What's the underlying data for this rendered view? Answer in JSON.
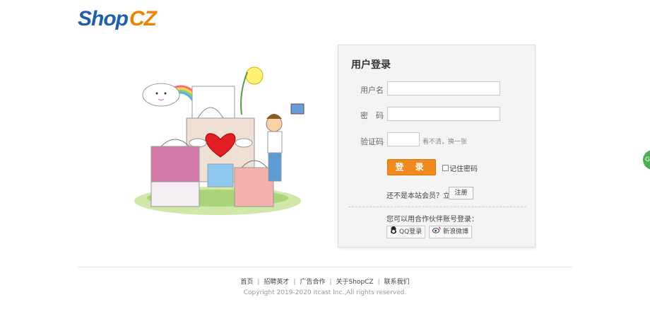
{
  "logo": {
    "shop": "Shop",
    "cz": "CZ"
  },
  "login": {
    "title": "用户登录",
    "username_label": "用户名",
    "password_label": "密　码",
    "captcha_label": "验证码",
    "captcha_hint": "看不清，换一张",
    "login_button": "登 录",
    "remember_label": "记住密码",
    "register_prompt": "还不是本站会员？立即",
    "register_button": "注册",
    "partner_prompt": "您可以用合作伙伴账号登录：",
    "qq_button": "QQ登录",
    "weibo_button": "新浪微博"
  },
  "footer": {
    "links": [
      "首页",
      "招聘英才",
      "广告合作",
      "关于ShopCZ",
      "联系我们"
    ],
    "copyright": "Copyright 2019-2020 itcast Inc.,All rights reserved."
  },
  "side_tab": {
    "label": "G"
  },
  "colors": {
    "brand_blue": "#1f5fb0",
    "brand_orange": "#f08300",
    "button_orange": "#f08a1c"
  }
}
